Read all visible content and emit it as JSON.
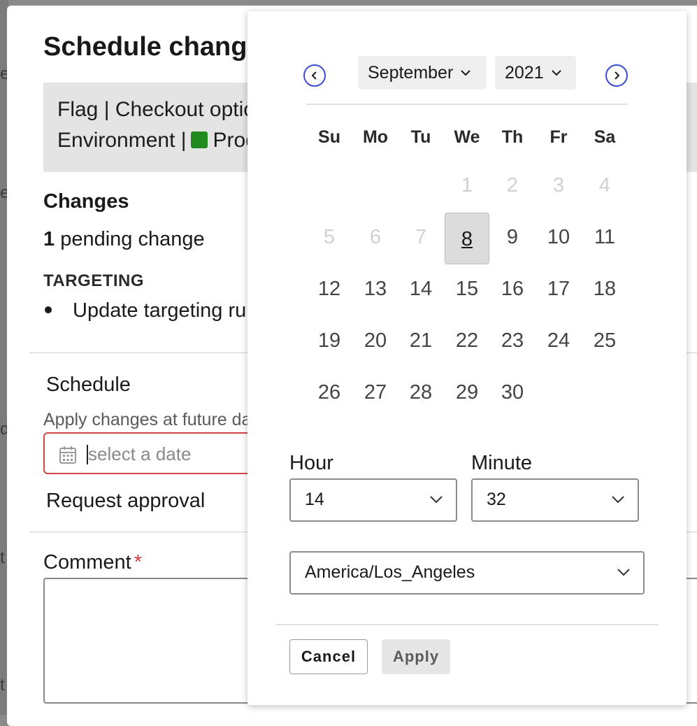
{
  "background": {
    "fragments": [
      "e",
      "e",
      "d",
      "t",
      "t"
    ]
  },
  "modal": {
    "title": "Schedule change",
    "summary": {
      "flag_line": "Flag | Checkout options",
      "environment_label": "Environment |",
      "environment_name": "Production",
      "environment_color": "#1f8a1f"
    },
    "changes_heading": "Changes",
    "pending_count": "1",
    "pending_text": "pending change",
    "targeting_heading": "TARGETING",
    "targeting_items": [
      "Update targeting rules"
    ],
    "schedule_heading": "Schedule",
    "schedule_help": "Apply changes at future date",
    "date_placeholder": "select a date",
    "request_approval": "Request approval",
    "comment_label": "Comment",
    "comment_required_mark": "*"
  },
  "date_picker": {
    "month": "September",
    "year": "2021",
    "weekdays": [
      "Su",
      "Mo",
      "Tu",
      "We",
      "Th",
      "Fr",
      "Sa"
    ],
    "disabled_days": [
      "1",
      "2",
      "3",
      "4",
      "5",
      "6",
      "7"
    ],
    "today": "8",
    "days_enabled": [
      "9",
      "10",
      "11",
      "12",
      "13",
      "14",
      "15",
      "16",
      "17",
      "18",
      "19",
      "20",
      "21",
      "22",
      "23",
      "24",
      "25",
      "26",
      "27",
      "28",
      "29",
      "30"
    ],
    "hour_label": "Hour",
    "hour_value": "14",
    "minute_label": "Minute",
    "minute_value": "32",
    "timezone": "America/Los_Angeles",
    "cancel_label": "Cancel",
    "apply_label": "Apply",
    "accent_color": "#3b4bd6"
  }
}
